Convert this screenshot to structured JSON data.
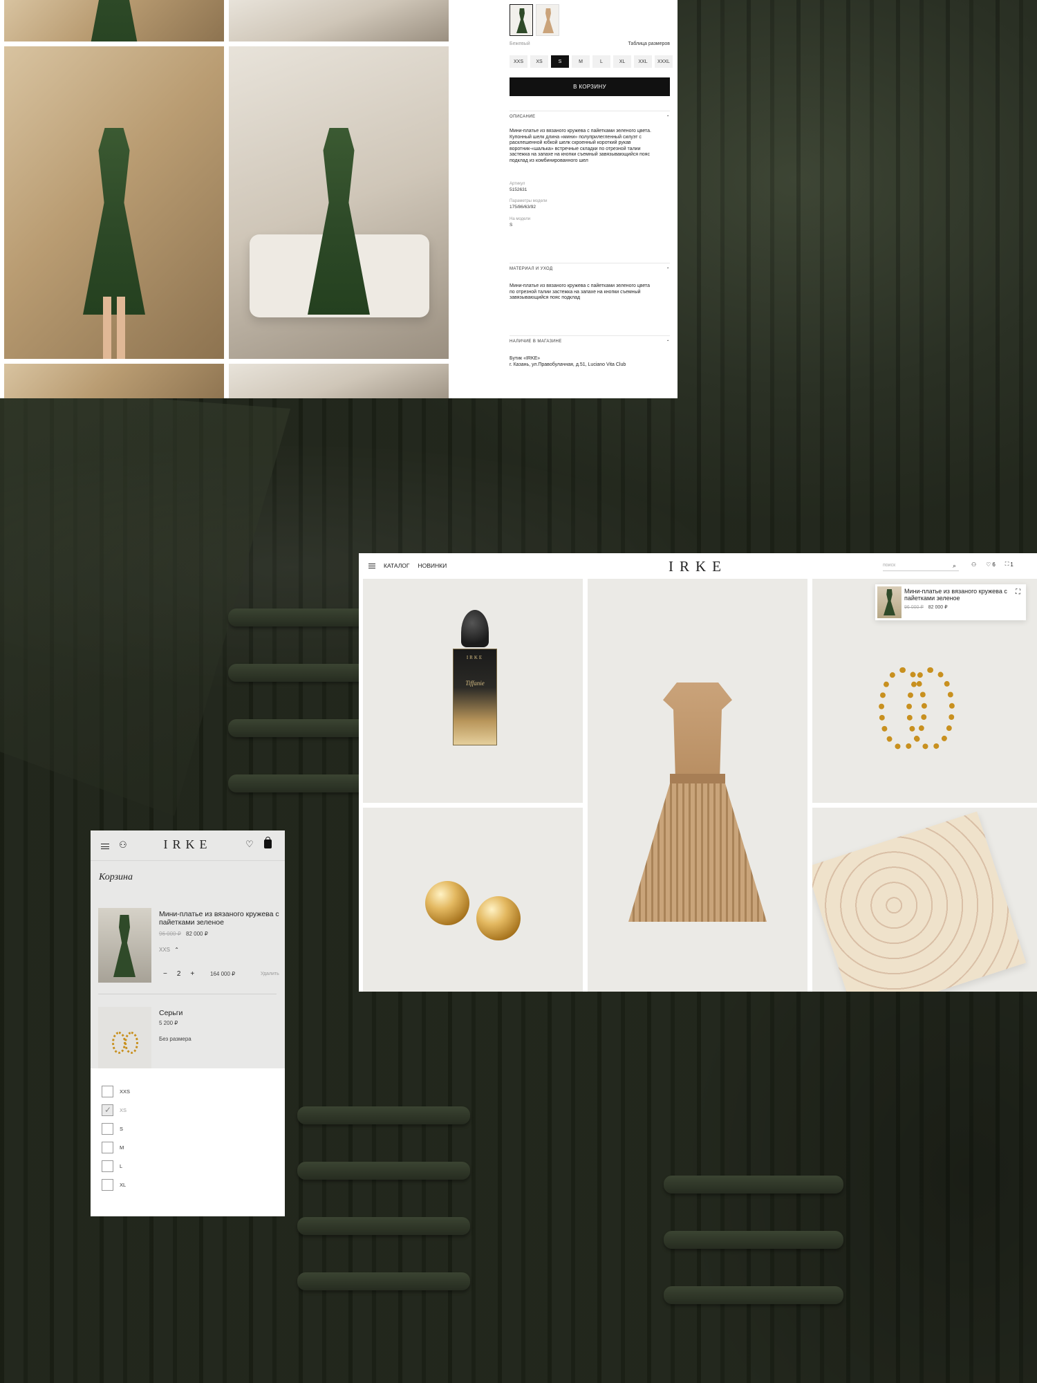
{
  "product": {
    "color_label": "Бежевый",
    "size_chart_link": "Таблица размеров",
    "sizes": [
      "XXS",
      "XS",
      "S",
      "M",
      "L",
      "XL",
      "XXL",
      "XXXL"
    ],
    "selected_size": "S",
    "add_to_cart": "В КОРЗИНУ",
    "sections": {
      "description": {
        "title": "ОПИСАНИЕ",
        "text": "Мини-платье из вязаного кружева с пайетками зеленого цвета. Купонный шелк длина «мини» полуприлегленный силуэт с расклешенной юбкой шелк скроенный короткий рукав воротник-«шалька» встречные складки по отрезной талии застежка на запахе на кнопки съемный завязывающийся пояс подклад из комбинированного шел",
        "article_label": "Артикул",
        "article_value": "5152631",
        "model_params_label": "Параметры модели",
        "model_params_value": "175/86/63/92",
        "on_model_label": "На модели",
        "on_model_value": "S"
      },
      "material": {
        "title": "МАТЕРИАЛ И УХОД",
        "text": "Мини-платье из вязаного кружева с пайетками зеленого цвета по отрезной талии застежка на запахе на кнопки съемный завязывающийся пояс подклад"
      },
      "availability": {
        "title": "НАЛИЧИЕ В МАГАЗИНЕ",
        "store_name": "Бутик «IRKE»",
        "store_address": "г. Казань, ул.Правобулачная, д.51, Luciano Vita Club"
      }
    },
    "colors": {
      "green": "#2f4a29",
      "beige": "#caa37a"
    }
  },
  "catalog": {
    "nav": [
      "КАТАЛОГ",
      "НОВИНКИ"
    ],
    "logo": "IRKE",
    "search_placeholder": "поиск",
    "wishlist_count": "6",
    "cart_count": "1",
    "perfume_label": "IRKE",
    "perfume_script": "Tiffanie",
    "mini_cart": {
      "title": "Мини-платье из вязаного кружева с пайетками зеленое",
      "old_price": "96 000 ₽",
      "price": "82 000 ₽"
    }
  },
  "mobile_cart": {
    "logo": "IRKE",
    "title": "Корзина",
    "items": [
      {
        "name": "Мини-платье из вязаного кружева с пайетками зеленое",
        "old_price": "96 000 ₽",
        "price": "82 000 ₽",
        "size": "XXS",
        "qty": "2",
        "total": "164 000 ₽",
        "remove": "Удалить"
      },
      {
        "name": "Серьги",
        "price": "5 200 ₽",
        "size": "Без размера"
      }
    ],
    "size_options": [
      "XXS",
      "XS",
      "S",
      "M",
      "L",
      "XL"
    ],
    "checked_size": "XS"
  }
}
